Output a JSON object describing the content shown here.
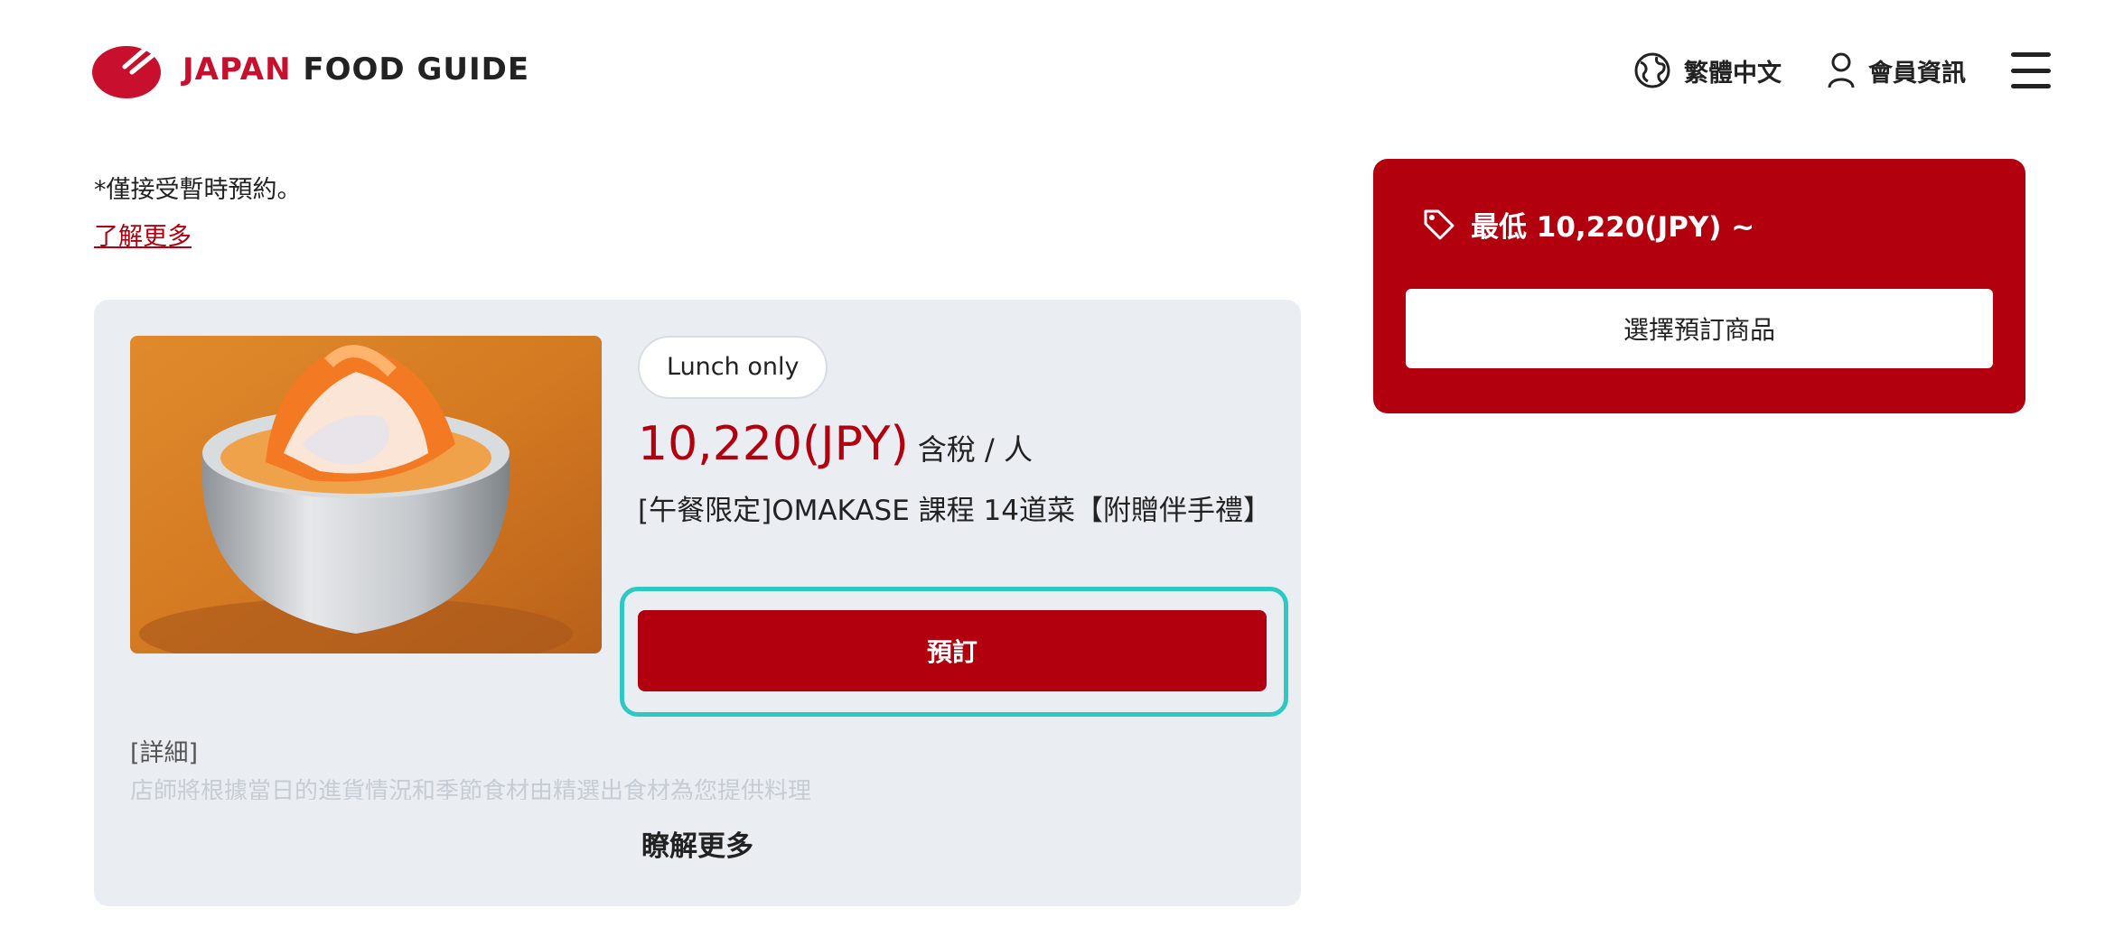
{
  "header": {
    "logo_primary": "JAPAN",
    "logo_secondary": "FOOD GUIDE",
    "language_label": "繁體中文",
    "member_label": "會員資訊"
  },
  "intro": {
    "notice": "*僅接受暫時預約。",
    "learn_more": "了解更多"
  },
  "product": {
    "badge": "Lunch only",
    "price": "10,220(JPY)",
    "price_note": "含稅 / 人",
    "title": "[午餐限定]OMAKASE 課程 14道菜【附贈伴手禮】",
    "book_label": "預訂",
    "detail_label": "[詳細]",
    "detail_text": "店師將根據當日的進貨情況和季節食材由精選出食材為您提供料理",
    "more_label": "瞭解更多"
  },
  "side_box": {
    "price_label": "最低 10,220(JPY) ~",
    "select_label": "選擇預訂商品"
  },
  "colors": {
    "brand_red": "#b3000f",
    "highlight": "#2ec9c2",
    "card_bg": "#eaeef3"
  }
}
